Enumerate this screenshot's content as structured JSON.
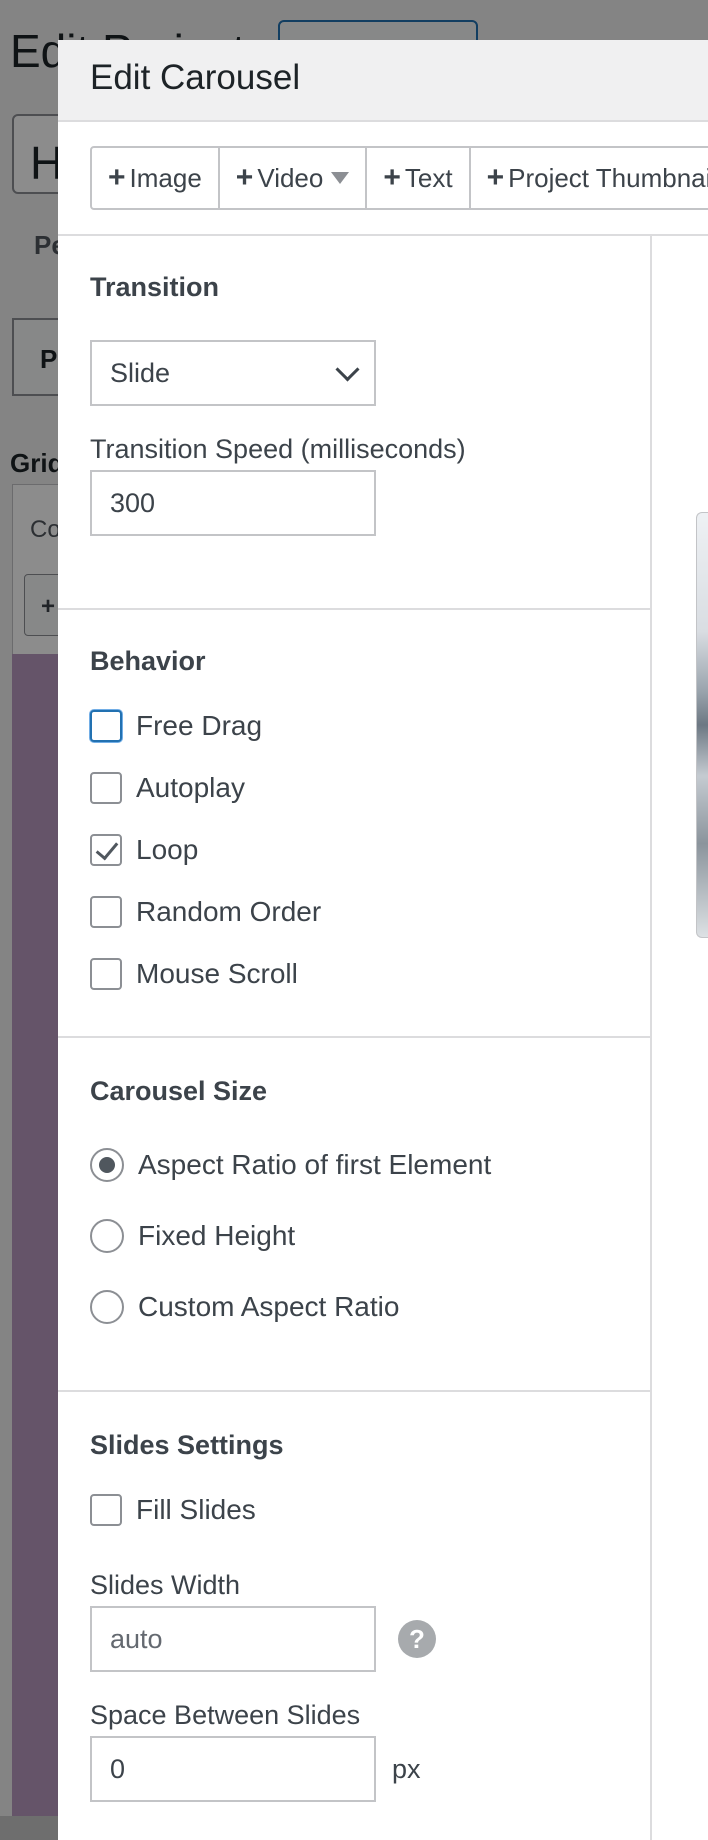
{
  "background": {
    "page_title": "Edit Project",
    "title_value": "H",
    "permalink_label": "Pe",
    "tab_label": "P",
    "grid_label": "Grid",
    "content_label": "Co",
    "add_label": "+"
  },
  "modal": {
    "title": "Edit Carousel",
    "toolbar": [
      {
        "label": "Image"
      },
      {
        "label": "Video"
      },
      {
        "label": "Text"
      },
      {
        "label": "Project Thumbnail"
      }
    ]
  },
  "transition": {
    "title": "Transition",
    "type_value": "Slide",
    "speed_label": "Transition Speed (milliseconds)",
    "speed_value": "300"
  },
  "behavior": {
    "title": "Behavior",
    "options": [
      {
        "label": "Free Drag",
        "checked": false
      },
      {
        "label": "Autoplay",
        "checked": false
      },
      {
        "label": "Loop",
        "checked": true
      },
      {
        "label": "Random Order",
        "checked": false
      },
      {
        "label": "Mouse Scroll",
        "checked": false
      }
    ]
  },
  "carousel_size": {
    "title": "Carousel Size",
    "options": [
      {
        "label": "Aspect Ratio of first Element",
        "selected": true
      },
      {
        "label": "Fixed Height",
        "selected": false
      },
      {
        "label": "Custom Aspect Ratio",
        "selected": false
      }
    ]
  },
  "slides_settings": {
    "title": "Slides Settings",
    "fill_slides_label": "Fill Slides",
    "fill_slides_checked": false,
    "width_label": "Slides Width",
    "width_placeholder": "auto",
    "space_label": "Space Between Slides",
    "space_value": "0",
    "space_unit": "px",
    "help_glyph": "?"
  },
  "icons": {
    "plus": "+",
    "help": "question-icon"
  },
  "colors": {
    "focus_blue": "#2271b1",
    "overlay": "rgba(0,0,0,0.45)"
  }
}
